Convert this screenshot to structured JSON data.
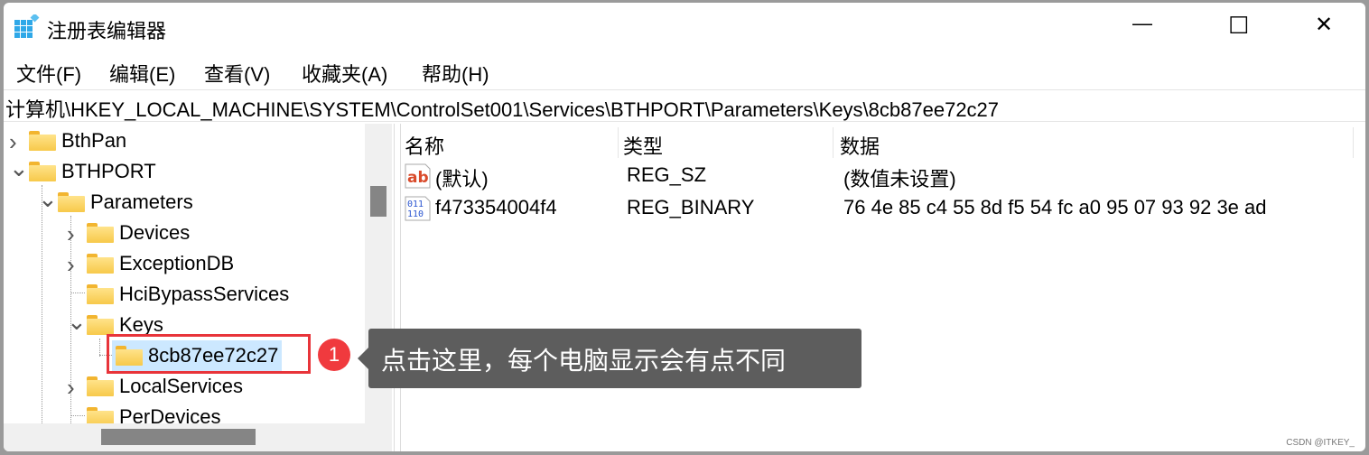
{
  "window": {
    "title": "注册表编辑器",
    "icon": "registry-editor-icon",
    "controls": {
      "minimize": "—",
      "maximize": "☐",
      "close": "✕"
    }
  },
  "menu": [
    "文件(F)",
    "编辑(E)",
    "查看(V)",
    "收藏夹(A)",
    "帮助(H)"
  ],
  "address": "计算机\\HKEY_LOCAL_MACHINE\\SYSTEM\\ControlSet001\\Services\\BTHPORT\\Parameters\\Keys\\8cb87ee72c27",
  "tree": [
    {
      "label": "BthPan",
      "level": 0,
      "state": "collapsed"
    },
    {
      "label": "BTHPORT",
      "level": 0,
      "state": "expanded"
    },
    {
      "label": "Parameters",
      "level": 1,
      "state": "expanded"
    },
    {
      "label": "Devices",
      "level": 2,
      "state": "collapsed"
    },
    {
      "label": "ExceptionDB",
      "level": 2,
      "state": "collapsed"
    },
    {
      "label": "HciBypassServices",
      "level": 2,
      "state": "leaf"
    },
    {
      "label": "Keys",
      "level": 2,
      "state": "expanded"
    },
    {
      "label": "8cb87ee72c27",
      "level": 3,
      "state": "leaf",
      "selected": true
    },
    {
      "label": "LocalServices",
      "level": 2,
      "state": "collapsed"
    },
    {
      "label": "PerDevices",
      "level": 2,
      "state": "leaf"
    }
  ],
  "columns": [
    "名称",
    "类型",
    "数据"
  ],
  "values": [
    {
      "icon": "string-value-icon",
      "name": "(默认)",
      "type": "REG_SZ",
      "data": "(数值未设置)"
    },
    {
      "icon": "binary-value-icon",
      "name": "f473354004f4",
      "type": "REG_BINARY",
      "data": "76 4e 85 c4 55 8d f5 54 fc a0 95 07 93 92 3e ad"
    }
  ],
  "annotation": {
    "number": "1",
    "text": "点击这里，每个电脑显示会有点不同",
    "color": "#e8343a"
  },
  "watermark": "CSDN @ITKEY_"
}
